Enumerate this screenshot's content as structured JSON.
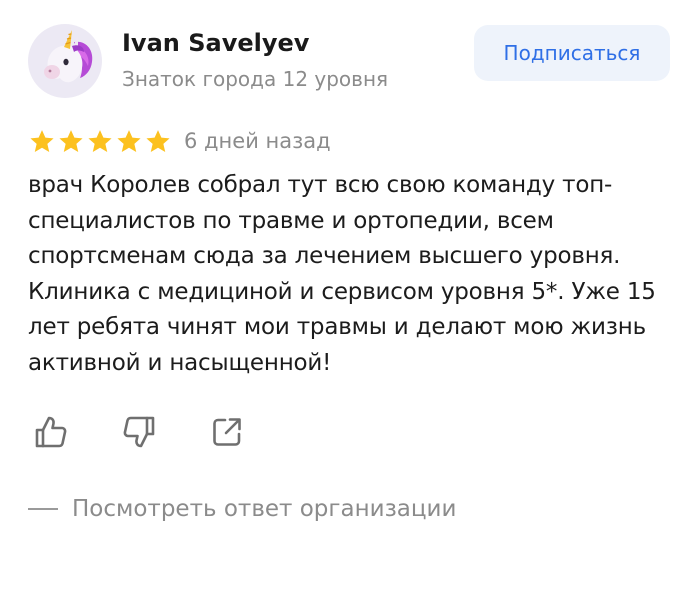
{
  "user": {
    "name": "Ivan Savelyev",
    "level": "Знаток города 12 уровня",
    "avatar_icon": "unicorn-emoji-icon"
  },
  "subscribe_label": "Подписаться",
  "review": {
    "rating": 5,
    "rating_max": 5,
    "date": "6 дней назад",
    "text": "врач Королев собрал тут всю свою команду топ-специалистов по травме и ортопедии, всем спортсменам сюда за лечением высшего уровня. Клиника с медициной и сервисом уровня 5*. Уже 15 лет ребята чинят мои травмы и делают мою жизнь активной и насыщенной!"
  },
  "actions": [
    "thumbs-up-icon",
    "thumbs-down-icon",
    "share-icon"
  ],
  "org_reply_label": "Посмотреть ответ организации",
  "colors": {
    "star": "#fcc11f",
    "accent": "#2f6fe6",
    "button_bg": "#eef3fb",
    "muted": "#8b8b8b"
  }
}
